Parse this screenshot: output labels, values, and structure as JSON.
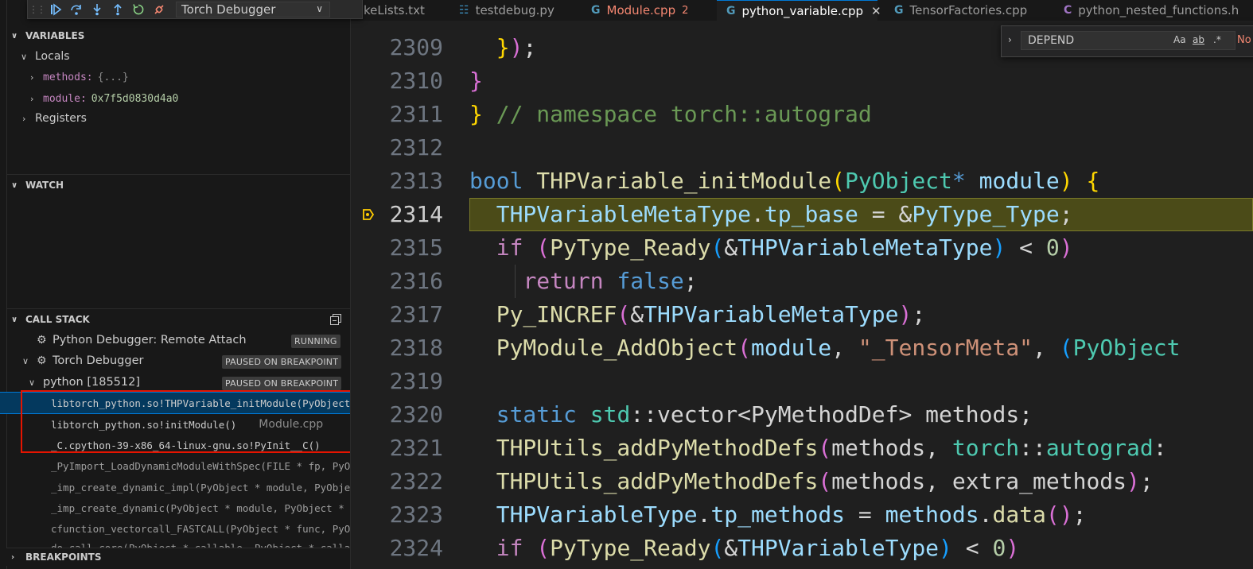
{
  "debug_toolbar": {
    "session": "Torch Debugger"
  },
  "tabs": [
    {
      "label": "keLists.txt",
      "icon": "none",
      "active": false
    },
    {
      "label": "testdebug.py",
      "icon": "python-icon",
      "active": false
    },
    {
      "label": "Module.cpp",
      "icon": "cpp-icon",
      "active": false,
      "modified_count": "2"
    },
    {
      "label": "python_variable.cpp",
      "icon": "cpp-icon",
      "active": true
    },
    {
      "label": "TensorFactories.cpp",
      "icon": "cpp-icon",
      "active": false
    },
    {
      "label": "python_nested_functions.h",
      "icon": "c-header-icon",
      "active": false
    }
  ],
  "find": {
    "query": "DEPEND",
    "opt_case": "Aa",
    "opt_word": "ab",
    "opt_regex": ".*",
    "result": "No"
  },
  "sidebar": {
    "variables": {
      "title": "VARIABLES",
      "locals_label": "Locals",
      "items": [
        {
          "name": "methods:",
          "value": "{...}"
        },
        {
          "name": "module:",
          "value": "0x7f5d0830d4a0"
        }
      ],
      "registers_label": "Registers"
    },
    "watch": {
      "title": "WATCH"
    },
    "call_stack": {
      "title": "CALL STACK",
      "sessions": [
        {
          "label": "Python Debugger: Remote Attach",
          "status": "RUNNING"
        },
        {
          "label": "Torch Debugger",
          "status": "PAUSED ON BREAKPOINT"
        }
      ],
      "thread": {
        "label": "python [185512]",
        "status": "PAUSED ON BREAKPOINT"
      },
      "frames": [
        {
          "fn": "libtorch_python.so!THPVariable_initModule(PyObject * module)",
          "file": ""
        },
        {
          "fn": "libtorch_python.so!initModule()",
          "file": "Module.cpp"
        },
        {
          "fn": "_C.cpython-39-x86_64-linux-gnu.so!PyInit__C()",
          "file": ""
        },
        {
          "fn": "_PyImport_LoadDynamicModuleWithSpec(FILE * fp, PyObject * spec)",
          "file": ""
        },
        {
          "fn": "_imp_create_dynamic_impl(PyObject * module, PyObject * spec)",
          "file": ""
        },
        {
          "fn": "_imp_create_dynamic(PyObject * module, PyObject * args)",
          "file": ""
        },
        {
          "fn": "cfunction_vectorcall_FASTCALL(PyObject * func, PyObject * args)",
          "file": ""
        },
        {
          "fn": "do_call_core(PyObject * callable, PyObject * callargs)",
          "file": ""
        }
      ]
    },
    "breakpoints": {
      "title": "BREAKPOINTS"
    }
  },
  "editor": {
    "line_numbers": [
      "2309",
      "2310",
      "2311",
      "2312",
      "2313",
      "2314",
      "2315",
      "2316",
      "2317",
      "2318",
      "2319",
      "2320",
      "2321",
      "2322",
      "2323",
      "2324"
    ],
    "current_line": "2314"
  },
  "colors": {
    "accent": "#0078d4",
    "highlight": "#4b4b18",
    "breakpoint_arrow": "#ffcc00",
    "red_annotation": "#e51400"
  }
}
